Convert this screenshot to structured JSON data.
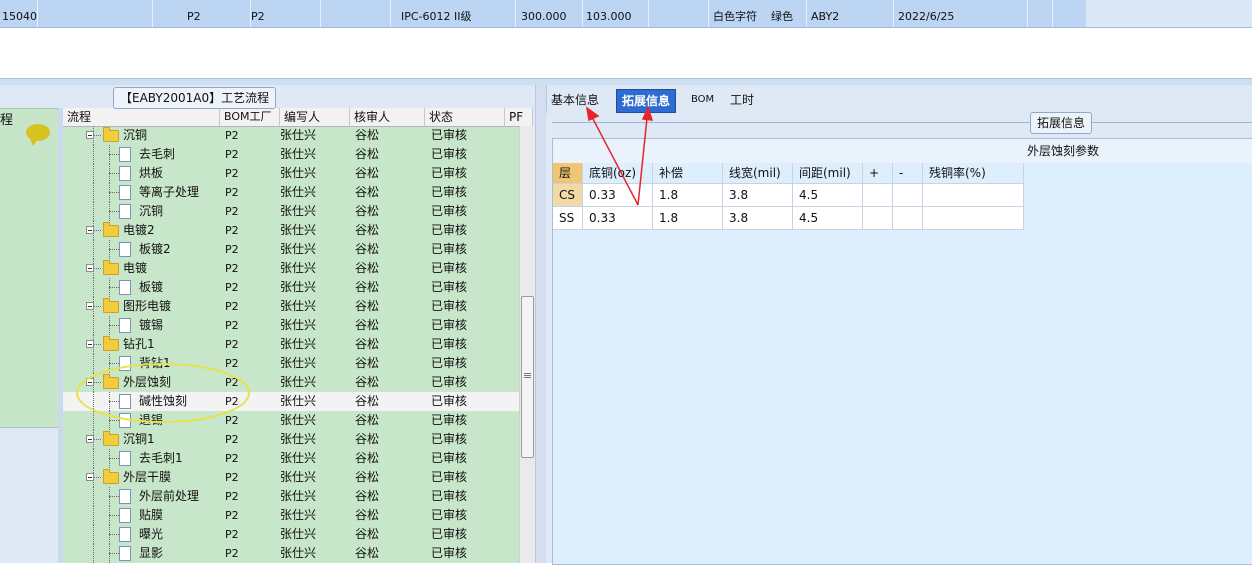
{
  "top_row": {
    "cells": [
      "15040",
      "P2",
      "P2",
      "IPC-6012 II级",
      "300.000",
      "103.000",
      "白色字符",
      "绿色",
      "ABY2",
      "2022/6/25"
    ]
  },
  "left_panel": {
    "header_text": "程"
  },
  "process_panel": {
    "legend": "【EABY2001A0】工艺流程",
    "columns": [
      "流程",
      "BOM工厂",
      "编写人",
      "核审人",
      "状态",
      "PF"
    ],
    "rows": [
      {
        "name": "沉铜",
        "level": 1,
        "factory": "P2",
        "author": "张仕兴",
        "reviewer": "谷松",
        "status": "已审核"
      },
      {
        "name": "去毛刺",
        "level": 2,
        "factory": "P2",
        "author": "张仕兴",
        "reviewer": "谷松",
        "status": "已审核"
      },
      {
        "name": "烘板",
        "level": 2,
        "factory": "P2",
        "author": "张仕兴",
        "reviewer": "谷松",
        "status": "已审核"
      },
      {
        "name": "等离子处理",
        "level": 2,
        "factory": "P2",
        "author": "张仕兴",
        "reviewer": "谷松",
        "status": "已审核"
      },
      {
        "name": "沉铜",
        "level": 2,
        "factory": "P2",
        "author": "张仕兴",
        "reviewer": "谷松",
        "status": "已审核"
      },
      {
        "name": "电镀2",
        "level": 1,
        "factory": "P2",
        "author": "张仕兴",
        "reviewer": "谷松",
        "status": "已审核"
      },
      {
        "name": "板镀2",
        "level": 2,
        "factory": "P2",
        "author": "张仕兴",
        "reviewer": "谷松",
        "status": "已审核"
      },
      {
        "name": "电镀",
        "level": 1,
        "factory": "P2",
        "author": "张仕兴",
        "reviewer": "谷松",
        "status": "已审核"
      },
      {
        "name": "板镀",
        "level": 2,
        "factory": "P2",
        "author": "张仕兴",
        "reviewer": "谷松",
        "status": "已审核"
      },
      {
        "name": "图形电镀",
        "level": 1,
        "factory": "P2",
        "author": "张仕兴",
        "reviewer": "谷松",
        "status": "已审核"
      },
      {
        "name": "镀锡",
        "level": 2,
        "factory": "P2",
        "author": "张仕兴",
        "reviewer": "谷松",
        "status": "已审核"
      },
      {
        "name": "钻孔1",
        "level": 1,
        "factory": "P2",
        "author": "张仕兴",
        "reviewer": "谷松",
        "status": "已审核"
      },
      {
        "name": "背钻1",
        "level": 2,
        "factory": "P2",
        "author": "张仕兴",
        "reviewer": "谷松",
        "status": "已审核"
      },
      {
        "name": "外层蚀刻",
        "level": 1,
        "factory": "P2",
        "author": "张仕兴",
        "reviewer": "谷松",
        "status": "已审核"
      },
      {
        "name": "碱性蚀刻",
        "level": 2,
        "factory": "P2",
        "author": "张仕兴",
        "reviewer": "谷松",
        "status": "已审核",
        "selected": true
      },
      {
        "name": "退锡",
        "level": 2,
        "factory": "P2",
        "author": "张仕兴",
        "reviewer": "谷松",
        "status": "已审核"
      },
      {
        "name": "沉铜1",
        "level": 1,
        "factory": "P2",
        "author": "张仕兴",
        "reviewer": "谷松",
        "status": "已审核"
      },
      {
        "name": "去毛刺1",
        "level": 2,
        "factory": "P2",
        "author": "张仕兴",
        "reviewer": "谷松",
        "status": "已审核"
      },
      {
        "name": "外层干膜",
        "level": 1,
        "factory": "P2",
        "author": "张仕兴",
        "reviewer": "谷松",
        "status": "已审核"
      },
      {
        "name": "外层前处理",
        "level": 2,
        "factory": "P2",
        "author": "张仕兴",
        "reviewer": "谷松",
        "status": "已审核"
      },
      {
        "name": "贴膜",
        "level": 2,
        "factory": "P2",
        "author": "张仕兴",
        "reviewer": "谷松",
        "status": "已审核"
      },
      {
        "name": "曝光",
        "level": 2,
        "factory": "P2",
        "author": "张仕兴",
        "reviewer": "谷松",
        "status": "已审核"
      },
      {
        "name": "显影",
        "level": 2,
        "factory": "P2",
        "author": "张仕兴",
        "reviewer": "谷松",
        "status": "已审核"
      }
    ]
  },
  "tabs": [
    {
      "label": "基本信息",
      "active": false
    },
    {
      "label": "拓展信息",
      "active": true
    },
    {
      "label": "BOM",
      "active": false
    },
    {
      "label": "工时",
      "active": false
    }
  ],
  "ext_panel": {
    "legend": "拓展信息",
    "group_title": "外层蚀刻参数",
    "columns": [
      "层",
      "底铜(oz)",
      "补偿",
      "线宽(mil)",
      "间距(mil)",
      "+",
      "-",
      "残铜率(%)"
    ],
    "rows": [
      [
        "CS",
        "0.33",
        "1.8",
        "3.8",
        "4.5",
        "",
        "",
        ""
      ],
      [
        "SS",
        "0.33",
        "1.8",
        "3.8",
        "4.5",
        "",
        "",
        ""
      ]
    ]
  },
  "colors": {
    "selection_blue": "#bcd5f3",
    "tree_green": "#c8e6c9",
    "active_tab": "#2e6cd1",
    "annotation_red": "#e8242a",
    "highlight_ellipse": "#e8e14a"
  }
}
